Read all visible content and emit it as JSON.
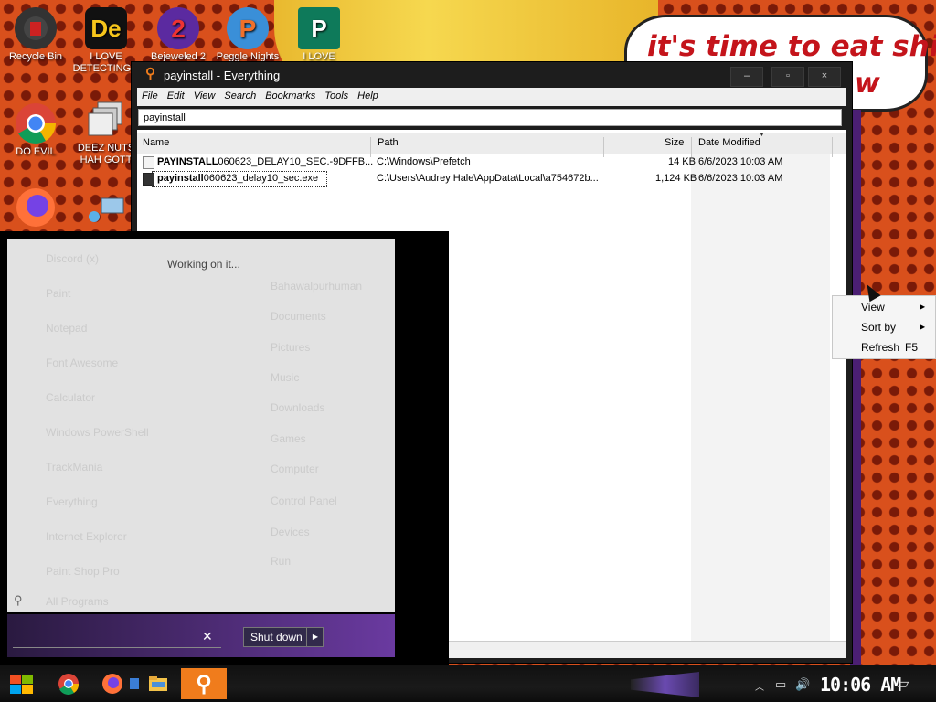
{
  "desktop": {
    "speech_bubble": {
      "line1": "it's time to eat shit",
      "line2": "w"
    },
    "icons": [
      {
        "label": "Recycle Bin",
        "icon": "recycle-bin-icon"
      },
      {
        "label": "I LOVE DETECTING...",
        "icon": "app-icon"
      },
      {
        "label": "Bejeweled 2",
        "icon": "app-icon"
      },
      {
        "label": "Peggle Nights",
        "icon": "app-icon"
      },
      {
        "label": "I LOVE",
        "icon": "publisher-icon"
      },
      {
        "label": "DO EVIL",
        "icon": "chrome-icon"
      },
      {
        "label": "DEEZ NUTS HAH GOTT",
        "icon": "app-icon"
      },
      {
        "label": "",
        "icon": "firefox-icon"
      },
      {
        "label": "",
        "icon": "network-icon"
      }
    ]
  },
  "window": {
    "title": "payinstall - Everything",
    "controls": {
      "minimize": "–",
      "maximize": "▫",
      "close": "×"
    },
    "menu": [
      "File",
      "Edit",
      "View",
      "Search",
      "Bookmarks",
      "Tools",
      "Help"
    ],
    "search_value": "payinstall",
    "columns": {
      "name": "Name",
      "path": "Path",
      "size": "Size",
      "date": "Date Modified"
    },
    "rows": [
      {
        "name_bold": "PAYINSTALL",
        "name_rest": "060623_DELAY10_SEC.-9DFFB...",
        "path": "C:\\Windows\\Prefetch",
        "size": "14 KB",
        "date": "6/6/2023 10:03 AM"
      },
      {
        "name_bold": "payinstall",
        "name_rest": "060623_delay10_sec.exe",
        "path": "C:\\Users\\Audrey Hale\\AppData\\Local\\a754672b...",
        "size": "1,124 KB",
        "date": "6/6/2023 10:03 AM"
      }
    ]
  },
  "start_menu": {
    "status": "Working on it...",
    "search_placeholder": "",
    "shutdown_label": "Shut down",
    "ghost_items_left": [
      "Discord (x)",
      "Paint",
      "Notepad",
      "Font Awesome",
      "Calculator",
      "Windows PowerShell",
      "TrackMania",
      "Everything",
      "Internet Explorer",
      "Paint Shop Pro",
      "All Programs"
    ],
    "ghost_items_right": [
      "Bahawalpurhuman",
      "Documents",
      "Pictures",
      "Music",
      "Downloads",
      "Games",
      "Computer",
      "Control Panel",
      "Devices",
      "Run"
    ]
  },
  "context_menu": {
    "items": [
      {
        "label": "View",
        "submenu": true
      },
      {
        "label": "Sort by",
        "submenu": true
      },
      {
        "label": "Refresh",
        "shortcut": "F5"
      }
    ]
  },
  "taskbar": {
    "clock": "10:06 AM",
    "apps": [
      "start-button",
      "chrome-icon",
      "firefox-icon",
      "generic-app-icon",
      "file-explorer-icon",
      "everything-icon"
    ]
  },
  "colors": {
    "accent_orange": "#f07c1c",
    "desktop_bg": "#d9501c",
    "bubble_text": "#c4141b"
  }
}
